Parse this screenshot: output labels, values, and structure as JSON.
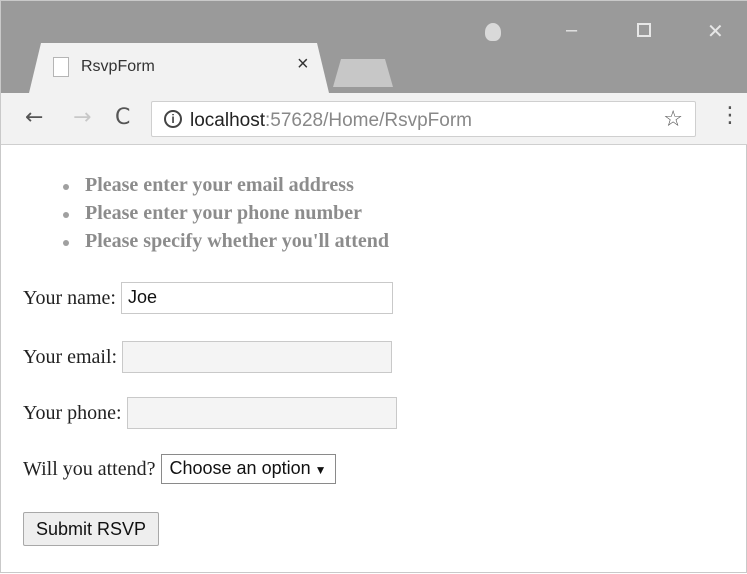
{
  "tab": {
    "title": "RsvpForm",
    "close_glyph": "×"
  },
  "window_controls": {
    "minimize": "–",
    "close": "✕"
  },
  "toolbar": {
    "url_host": "localhost",
    "url_rest": ":57628/Home/RsvpForm",
    "back_glyph": "←",
    "forward_glyph": "→",
    "reload_glyph": "C",
    "info_glyph": "i",
    "star_glyph": "☆",
    "menu_glyph": "⋮"
  },
  "validation_errors": [
    "Please enter your email address",
    "Please enter your phone number",
    "Please specify whether you'll attend"
  ],
  "form": {
    "name_label": "Your name:",
    "name_value": "Joe",
    "email_label": "Your email:",
    "email_value": "",
    "phone_label": "Your phone:",
    "phone_value": "",
    "attend_label": "Will you attend?",
    "attend_selected": "Choose an option",
    "attend_caret": "▼",
    "submit_label": "Submit RSVP"
  },
  "colors": {
    "error_text": "#8c8c8c",
    "invalid_field_bg": "#f4f4f4",
    "titlebar": "#9a9a9a"
  }
}
